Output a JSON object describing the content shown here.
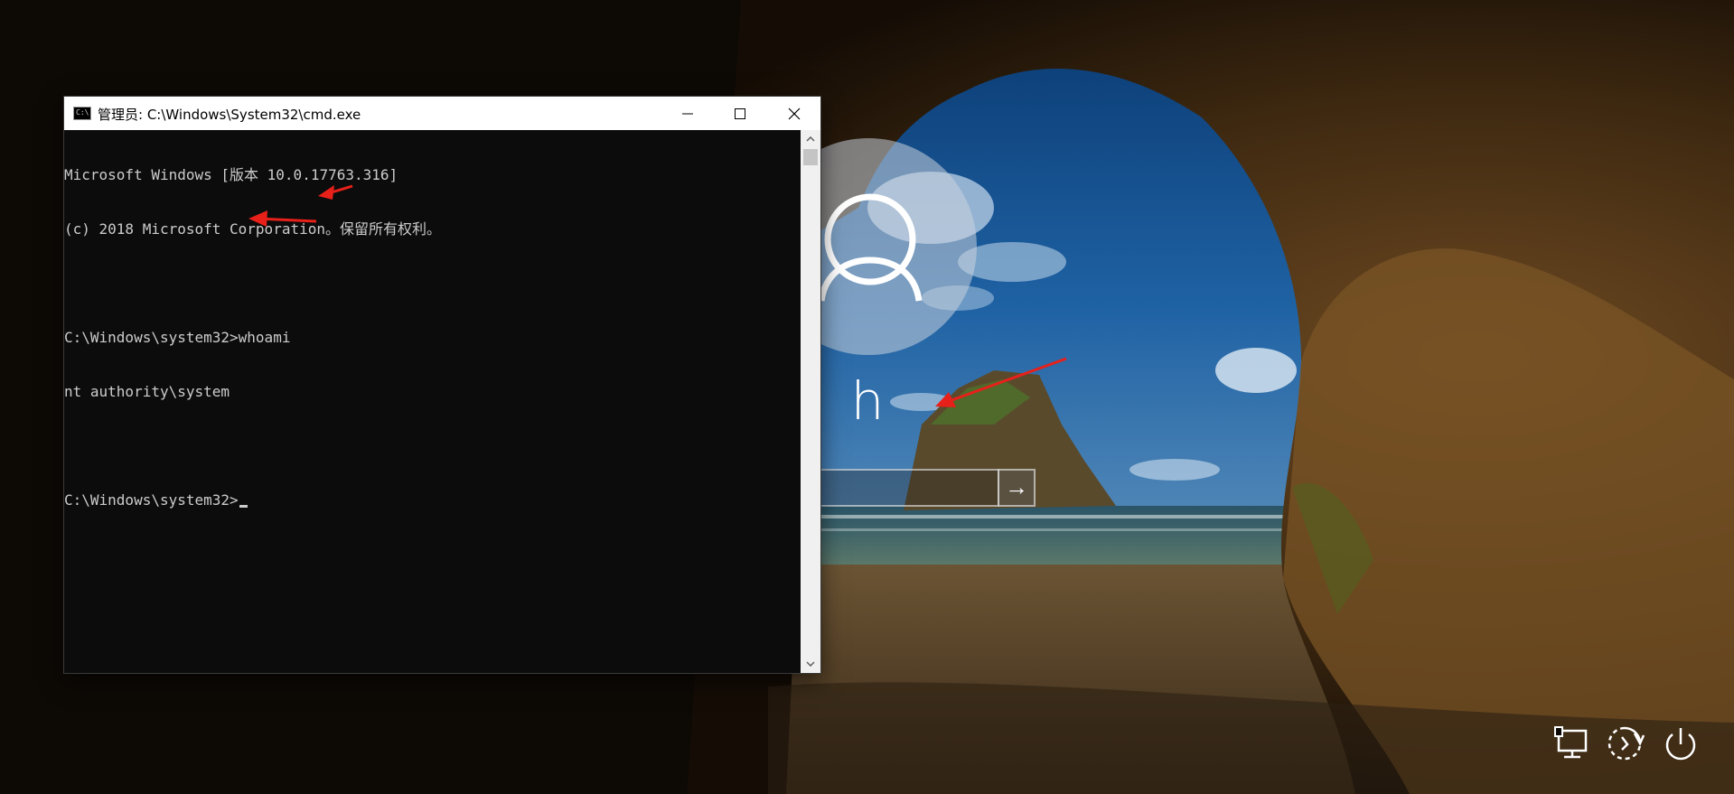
{
  "cmd_window": {
    "title": "管理员: C:\\Windows\\System32\\cmd.exe",
    "icon_text": "C:\\",
    "lines": [
      "Microsoft Windows [版本 10.0.17763.316]",
      "(c) 2018 Microsoft Corporation。保留所有权利。",
      "",
      "C:\\Windows\\system32>whoami",
      "nt authority\\system",
      "",
      "C:\\Windows\\system32>"
    ]
  },
  "lock_screen": {
    "user_name": "h",
    "submit_glyph": "→"
  },
  "icons": {
    "minimize": "minimize-icon",
    "maximize": "maximize-icon",
    "close": "close-icon",
    "network": "network-icon",
    "ease_of_access": "ease-of-access-icon",
    "power": "power-icon",
    "avatar": "user-silhouette-icon"
  },
  "colors": {
    "console_bg": "#0c0c0c",
    "console_text": "#cccccc",
    "annotation_arrow": "#e8201a"
  }
}
